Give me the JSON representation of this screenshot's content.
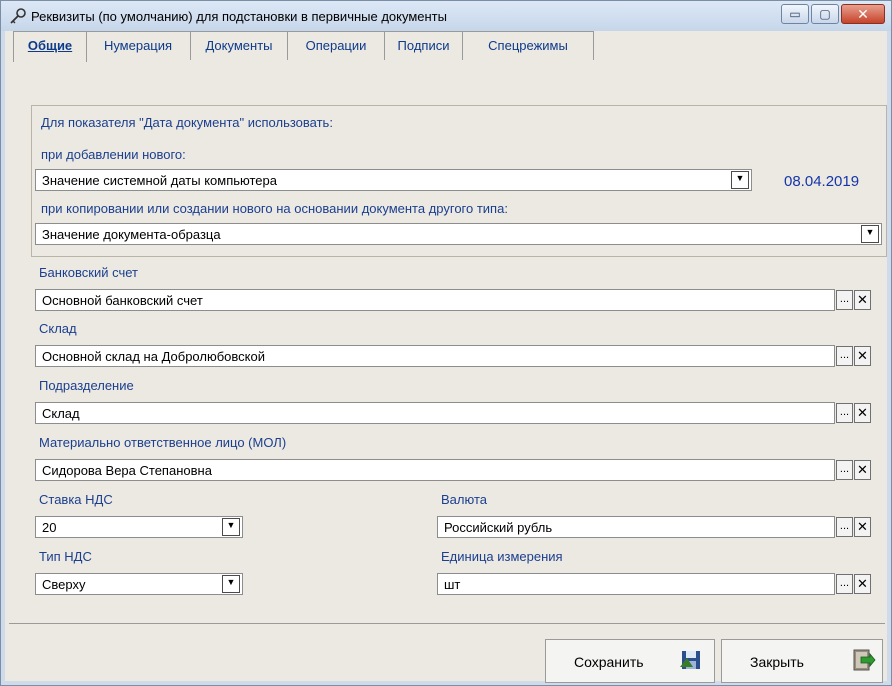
{
  "window": {
    "title": "Реквизиты (по умолчанию) для подстановки в первичные документы",
    "minimize_glyph": "▭",
    "maximize_glyph": "▢",
    "close_glyph": "✕"
  },
  "tabs": [
    {
      "label": "Общие",
      "active": true
    },
    {
      "label": "Нумерация",
      "active": false
    },
    {
      "label": "Документы",
      "active": false
    },
    {
      "label": "Операции",
      "active": false
    },
    {
      "label": "Подписи",
      "active": false
    },
    {
      "label": "Спецрежимы",
      "active": false
    }
  ],
  "date_section": {
    "heading": "Для показателя \"Дата документа\" использовать:",
    "on_add_label": "при добавлении нового:",
    "on_add_value": "Значение системной даты компьютера",
    "date": "08.04.2019",
    "on_copy_label": "при копировании или создании нового на основании документа другого типа:",
    "on_copy_value": "Значение документа-образца"
  },
  "fields": {
    "bank_label": "Банковский счет",
    "bank_value": "Основной банковский счет",
    "warehouse_label": "Склад",
    "warehouse_value": "Основной склад на Добролюбовской",
    "division_label": "Подразделение",
    "division_value": "Склад",
    "mol_label": "Материально ответственное лицо (МОЛ)",
    "mol_value": "Сидорова Вера Степановна",
    "vat_rate_label": "Ставка НДС",
    "vat_rate_value": "20",
    "currency_label": "Валюта",
    "currency_value": "Российский рубль",
    "vat_type_label": "Тип НДС",
    "vat_type_value": "Сверху",
    "unit_label": "Единица измерения",
    "unit_value": "шт"
  },
  "glyphs": {
    "dropdown": "▼",
    "browse": "...",
    "clear": "✕"
  },
  "footer": {
    "save_label": "Сохранить",
    "close_label": "Закрыть"
  },
  "colors": {
    "label_blue": "#1b3f8f",
    "date_blue": "#1536a8",
    "tab_blue": "#0d3a8b"
  }
}
